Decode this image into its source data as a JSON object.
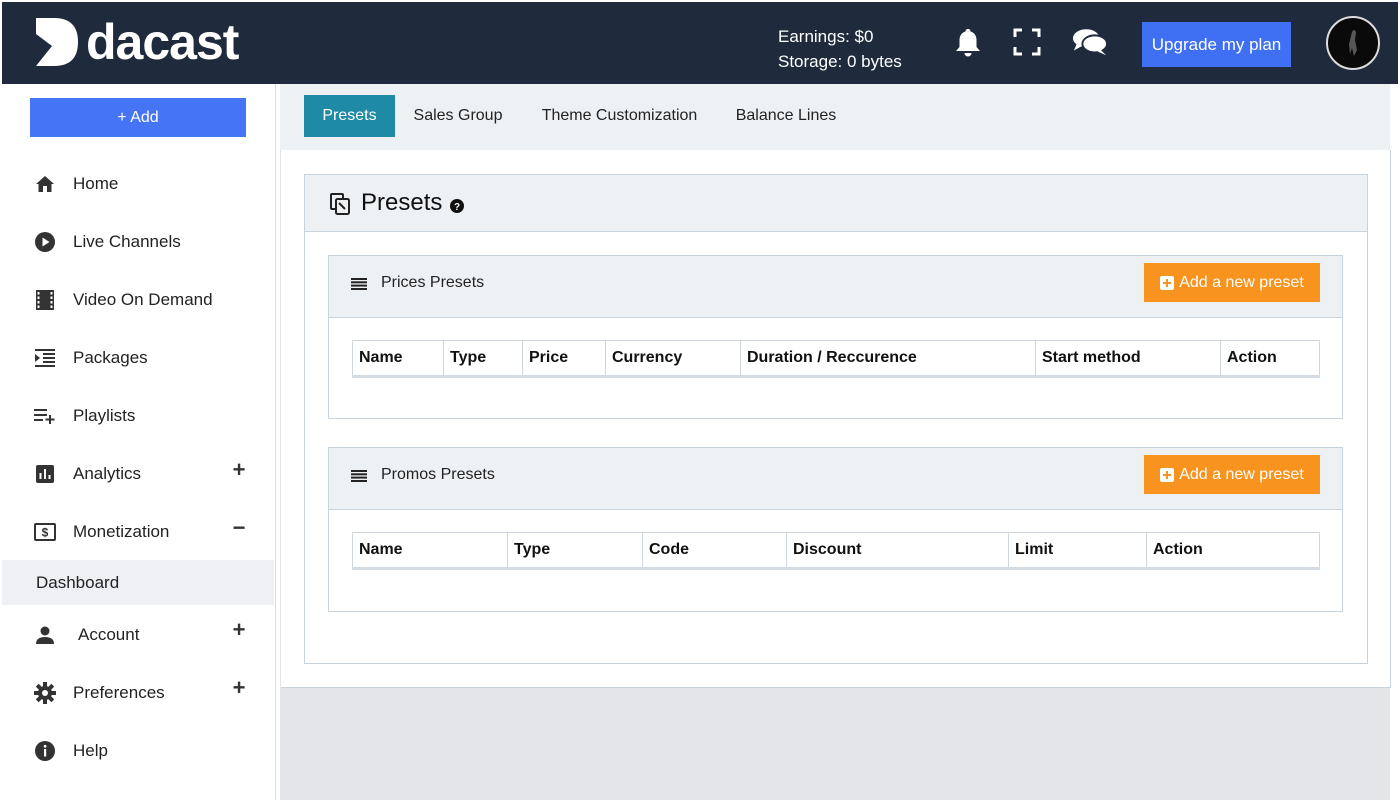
{
  "brand": {
    "name": "dacast"
  },
  "header": {
    "earnings": "Earnings: $0",
    "storage": "Storage: 0 bytes",
    "icons": [
      "bell-icon",
      "fullscreen-icon",
      "chat-icon"
    ],
    "upgrade_label": "Upgrade my plan"
  },
  "sidebar": {
    "add_label": "+ Add",
    "items": [
      {
        "label": "Home",
        "icon": "home-icon"
      },
      {
        "label": "Live Channels",
        "icon": "play-circle-icon"
      },
      {
        "label": "Video On Demand",
        "icon": "film-icon"
      },
      {
        "label": "Packages",
        "icon": "packages-icon"
      },
      {
        "label": "Playlists",
        "icon": "playlist-add-icon"
      },
      {
        "label": "Analytics",
        "icon": "bar-chart-icon",
        "toggle": "+"
      },
      {
        "label": "Monetization",
        "icon": "dollar-icon",
        "toggle": "−"
      },
      {
        "label": "Account",
        "icon": "person-icon",
        "toggle": "+"
      },
      {
        "label": "Preferences",
        "icon": "gear-icon",
        "toggle": "+"
      },
      {
        "label": "Help",
        "icon": "info-icon"
      }
    ],
    "sub_item": "Dashboard"
  },
  "tabs": [
    "Presets",
    "Sales Group",
    "Theme Customization",
    "Balance Lines"
  ],
  "page": {
    "title": "Presets",
    "prices": {
      "title": "Prices Presets",
      "add_label": "Add a new preset",
      "columns": [
        "Name",
        "Type",
        "Price",
        "Currency",
        "Duration / Reccurence",
        "Start method",
        "Action"
      ]
    },
    "promos": {
      "title": "Promos Presets",
      "add_label": "Add a new preset",
      "columns": [
        "Name",
        "Type",
        "Code",
        "Discount",
        "Limit",
        "Action"
      ]
    }
  },
  "colors": {
    "topbar": "#1f2a3c",
    "primary_blue": "#4575f4",
    "tab_active": "#1e8aa5",
    "orange": "#f7931e"
  }
}
